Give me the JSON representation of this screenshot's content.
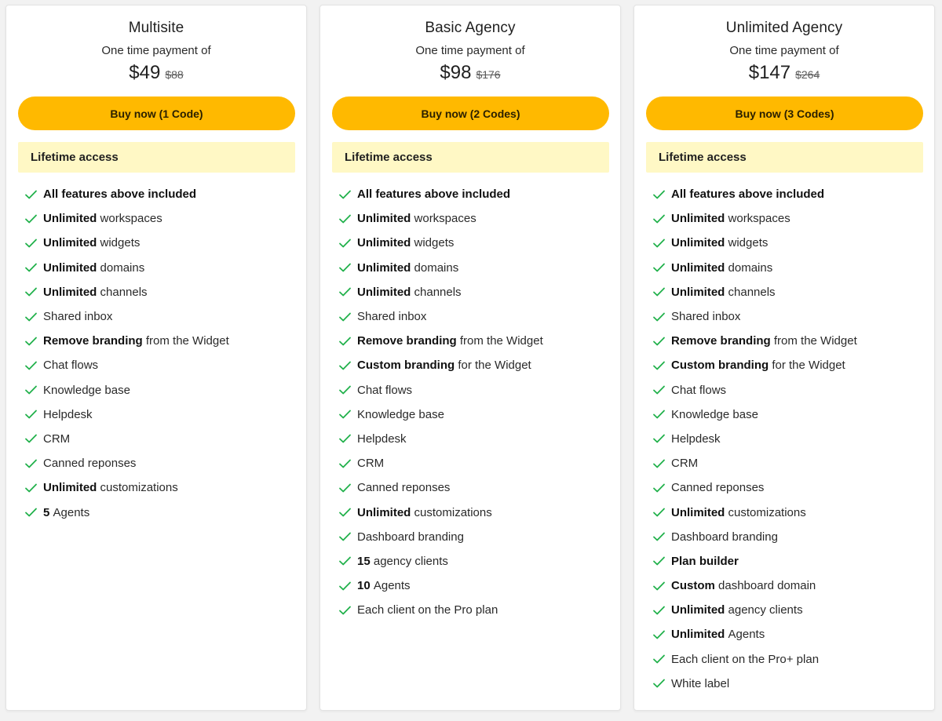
{
  "plans": [
    {
      "name": "Multisite",
      "payment_label": "One time payment of",
      "price": "$49",
      "old_price": "$88",
      "button_label": "Buy now (1 Code)",
      "lifetime_label": "Lifetime access",
      "features": [
        {
          "bold": "All features above included",
          "text": ""
        },
        {
          "bold": "Unlimited",
          "text": "workspaces"
        },
        {
          "bold": "Unlimited",
          "text": "widgets"
        },
        {
          "bold": "Unlimited",
          "text": "domains"
        },
        {
          "bold": "Unlimited",
          "text": "channels"
        },
        {
          "bold": "",
          "text": "Shared inbox"
        },
        {
          "bold": "Remove branding",
          "text": "from the Widget"
        },
        {
          "bold": "",
          "text": "Chat flows"
        },
        {
          "bold": "",
          "text": "Knowledge base"
        },
        {
          "bold": "",
          "text": "Helpdesk"
        },
        {
          "bold": "",
          "text": "CRM"
        },
        {
          "bold": "",
          "text": "Canned reponses"
        },
        {
          "bold": "Unlimited",
          "text": "customizations"
        },
        {
          "bold": "5",
          "text": "Agents"
        }
      ]
    },
    {
      "name": "Basic Agency",
      "payment_label": "One time payment of",
      "price": "$98",
      "old_price": "$176",
      "button_label": "Buy now (2 Codes)",
      "lifetime_label": "Lifetime access",
      "features": [
        {
          "bold": "All features above included",
          "text": ""
        },
        {
          "bold": "Unlimited",
          "text": "workspaces"
        },
        {
          "bold": "Unlimited",
          "text": "widgets"
        },
        {
          "bold": "Unlimited",
          "text": "domains"
        },
        {
          "bold": "Unlimited",
          "text": "channels"
        },
        {
          "bold": "",
          "text": "Shared inbox"
        },
        {
          "bold": "Remove branding",
          "text": "from the Widget"
        },
        {
          "bold": "Custom branding",
          "text": "for the Widget"
        },
        {
          "bold": "",
          "text": "Chat flows"
        },
        {
          "bold": "",
          "text": "Knowledge base"
        },
        {
          "bold": "",
          "text": "Helpdesk"
        },
        {
          "bold": "",
          "text": "CRM"
        },
        {
          "bold": "",
          "text": "Canned reponses"
        },
        {
          "bold": "Unlimited",
          "text": "customizations"
        },
        {
          "bold": "",
          "text": "Dashboard branding"
        },
        {
          "bold": "15",
          "text": "agency clients"
        },
        {
          "bold": "10",
          "text": "Agents"
        },
        {
          "bold": "",
          "text": "Each client on the Pro plan"
        }
      ]
    },
    {
      "name": "Unlimited Agency",
      "payment_label": "One time payment of",
      "price": "$147",
      "old_price": "$264",
      "button_label": "Buy now (3 Codes)",
      "lifetime_label": "Lifetime access",
      "features": [
        {
          "bold": "All features above included",
          "text": ""
        },
        {
          "bold": "Unlimited",
          "text": "workspaces"
        },
        {
          "bold": "Unlimited",
          "text": "widgets"
        },
        {
          "bold": "Unlimited",
          "text": "domains"
        },
        {
          "bold": "Unlimited",
          "text": "channels"
        },
        {
          "bold": "",
          "text": "Shared inbox"
        },
        {
          "bold": "Remove branding",
          "text": "from the Widget"
        },
        {
          "bold": "Custom branding",
          "text": "for the Widget"
        },
        {
          "bold": "",
          "text": "Chat flows"
        },
        {
          "bold": "",
          "text": "Knowledge base"
        },
        {
          "bold": "",
          "text": "Helpdesk"
        },
        {
          "bold": "",
          "text": "CRM"
        },
        {
          "bold": "",
          "text": "Canned reponses"
        },
        {
          "bold": "Unlimited",
          "text": "customizations"
        },
        {
          "bold": "",
          "text": "Dashboard branding"
        },
        {
          "bold": "Plan builder",
          "text": ""
        },
        {
          "bold": "Custom",
          "text": "dashboard domain"
        },
        {
          "bold": "Unlimited",
          "text": "agency clients"
        },
        {
          "bold": "Unlimited",
          "text": "Agents"
        },
        {
          "bold": "",
          "text": "Each client on the Pro+ plan"
        },
        {
          "bold": "",
          "text": "White label"
        }
      ]
    }
  ],
  "icons": {
    "feature": "check-icon"
  },
  "colors": {
    "button": "#ffb900",
    "lifetime_bg": "#fff8c5",
    "check": "#22b14c"
  }
}
